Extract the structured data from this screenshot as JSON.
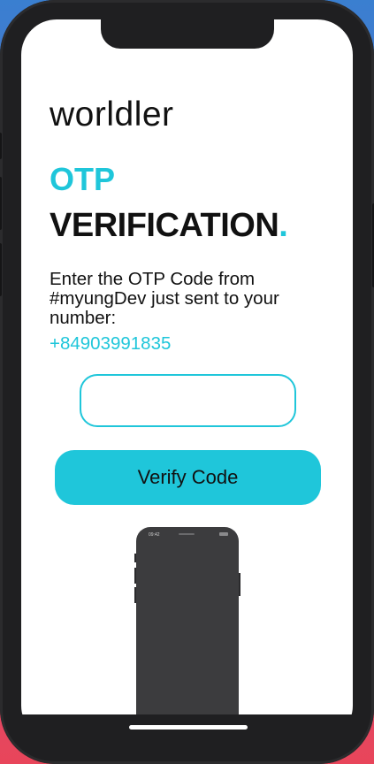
{
  "app": {
    "logo_text": "worldler"
  },
  "header": {
    "title_line1": "OTP",
    "title_line2": "VERIFICATION",
    "title_dot": "."
  },
  "message": {
    "instruction": "Enter the OTP Code from #myungDev just sent to your number:",
    "phone_number": "+84903991835"
  },
  "form": {
    "otp_value": "",
    "otp_placeholder": "",
    "verify_label": "Verify Code"
  },
  "preview": {
    "status_time": "09:42"
  },
  "colors": {
    "accent": "#1fc6da",
    "text": "#111111",
    "device": "#1f1f21"
  },
  "icons": [
    "home-indicator"
  ]
}
